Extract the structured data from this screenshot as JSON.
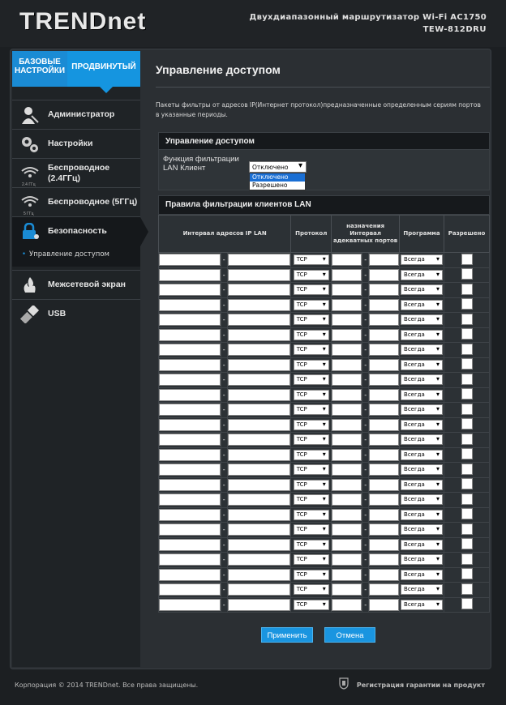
{
  "header": {
    "logo": "TRENDnet",
    "product_line1": "Двухдиапазонный маршрутизатор Wi-Fi AC1750",
    "product_line2": "TEW-812DRU"
  },
  "sidebar": {
    "tab_basic": "БАЗОВЫЕ НАСТРОЙКИ",
    "tab_advanced": "ПРОДВИНУТЫЙ",
    "items": [
      {
        "label": "Администратор",
        "icon": "admin-icon"
      },
      {
        "label": "Настройки",
        "icon": "gears-icon"
      },
      {
        "label": "Беспроводное (2.4ГГц)",
        "icon": "wifi-24-icon"
      },
      {
        "label": "Беспроводное (5ГГц)",
        "icon": "wifi-5-icon"
      },
      {
        "label": "Безопасность",
        "icon": "lock-icon"
      },
      {
        "label": "Межсетевой экран",
        "icon": "firewall-icon"
      },
      {
        "label": "USB",
        "icon": "usb-icon"
      }
    ],
    "sub_item": "Управление доступом",
    "wifi24_sub": "2.4 ГГц",
    "wifi5_sub": "5 ГГц"
  },
  "main": {
    "title": "Управление доступом",
    "description": "Пакеты фильтры от адресов IP(Интернет протокол)предназначенные определенным сериям портов в указанные периоды.",
    "section1_title": "Управление доступом",
    "filter_label": "Функция фильтрации LAN Клиент",
    "filter_value": "Отключено",
    "filter_options": [
      "Отключено",
      "Разрешено"
    ],
    "section2_title": "Правила фильтрации клиентов LAN",
    "columns": {
      "ip_range": "Интервал адресов IP LAN",
      "protocol": "Протокол",
      "ports": "назначения Интервал адекватных портов",
      "schedule": "Программа",
      "allowed": "Разрешено"
    },
    "row_protocol": "TCP",
    "row_schedule": "Всегда",
    "dash": "-",
    "apply": "Применить",
    "cancel": "Отмена"
  },
  "footer": {
    "copyright": "Корпорация © 2014 TRENDnet. Все права защищены.",
    "warranty": "Регистрация гарантии на продукт"
  }
}
